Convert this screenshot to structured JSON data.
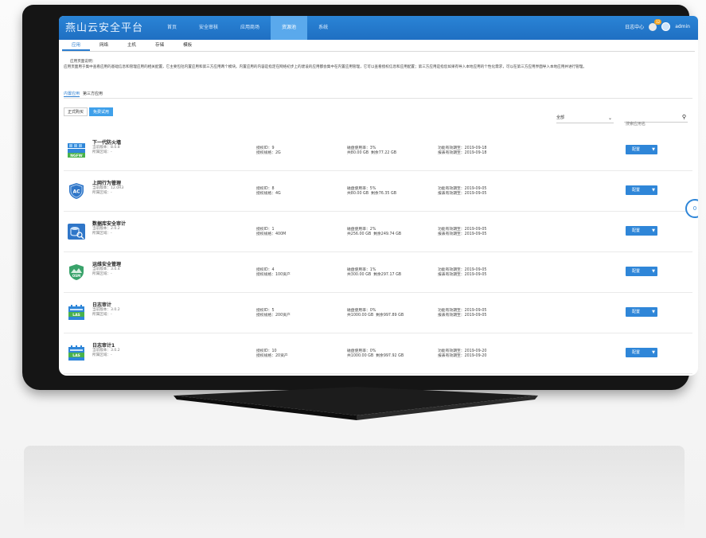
{
  "app": {
    "title": "燕山云安全平台",
    "nav": [
      "首页",
      "安全审核",
      "应用商场",
      "资源池",
      "系统"
    ],
    "nav_active_index": 3,
    "top_right": {
      "link": "日志中心",
      "badge": "12",
      "user": "admin"
    }
  },
  "subtabs": {
    "items": [
      "应用",
      "网络",
      "主机",
      "存储",
      "模板"
    ],
    "active_index": 0
  },
  "description": {
    "title": "应用页面说明：",
    "body": "应用页面用于集中查看应用的基础信息和管理应用的相关配置，它主要包括内置应用和第三方应用两个模块。内置应用的内容是指定在网络初步上的建设的应用都会集中在内置应用管理，它可以查看授权信息和应用配置；第三方应用是指您如果有导入本地应用的个性化需求，可以在第三方应用界面导入本地应用并进行管理。"
  },
  "category_tabs": {
    "items": [
      "内置应用",
      "第三方应用"
    ],
    "active_index": 0
  },
  "filters": {
    "items": [
      "正式购买",
      "免费试用"
    ],
    "active_index": 1
  },
  "select": {
    "value": "全部"
  },
  "search": {
    "placeholder": "搜索应用名"
  },
  "apps": [
    {
      "name": "下一代防火墙",
      "version": "当前版本：8.0.8",
      "zone": "所属区域：-",
      "auth_id": "授权ID：9",
      "auth_spec": "授权规格：2G",
      "disk_usage": "磁盘使用率：3%",
      "disk_total": "共80.00 GB",
      "disk_left": "剩余77.22 GB",
      "func_expire": "功能有效期至：2019-09-18",
      "report_expire": "报表有效期至：2019-09-18",
      "icon": "ngfw-icon",
      "config_label": "配置"
    },
    {
      "name": "上网行为管理",
      "version": "当前版本：12.0R3",
      "zone": "所属区域：-",
      "auth_id": "授权ID：8",
      "auth_spec": "授权规格：4G",
      "disk_usage": "磁盘使用率：5%",
      "disk_total": "共80.00 GB",
      "disk_left": "剩余76.35 GB",
      "func_expire": "功能有效期至：2019-09-05",
      "report_expire": "报表有效期至：2019-09-05",
      "icon": "ac-shield-icon",
      "config_label": "配置"
    },
    {
      "name": "数据库安全审计",
      "version": "当前版本：2.0.2",
      "zone": "所属区域：-",
      "auth_id": "授权ID：1",
      "auth_spec": "授权规格：400M",
      "disk_usage": "磁盘使用率：2%",
      "disk_total": "共256.00 GB",
      "disk_left": "剩余249.74 GB",
      "func_expire": "功能有效期至：2019-09-05",
      "report_expire": "报表有效期至：2019-09-05",
      "icon": "database-audit-icon",
      "config_label": "配置"
    },
    {
      "name": "运维安全管理",
      "version": "当前版本：3.0.4",
      "zone": "所属区域：-",
      "auth_id": "授权ID：4",
      "auth_spec": "授权规格：100资产",
      "disk_usage": "磁盘使用率：1%",
      "disk_total": "共300.00 GB",
      "disk_left": "剩余297.17 GB",
      "func_expire": "功能有效期至：2019-09-05",
      "report_expire": "报表有效期至：2019-09-05",
      "icon": "osm-icon",
      "config_label": "配置"
    },
    {
      "name": "日志审计",
      "version": "当前版本：3.0.2",
      "zone": "所属区域：-",
      "auth_id": "授权ID：5",
      "auth_spec": "授权规格：200资产",
      "disk_usage": "磁盘使用率：0%",
      "disk_total": "共1000.00 GB",
      "disk_left": "剩余997.89 GB",
      "func_expire": "功能有效期至：2019-09-05",
      "report_expire": "报表有效期至：2019-09-05",
      "icon": "las-calendar-icon",
      "config_label": "配置"
    },
    {
      "name": "日志审计1",
      "version": "当前版本：3.0.2",
      "zone": "所属区域：-",
      "auth_id": "授权ID：10",
      "auth_spec": "授权规格：20资产",
      "disk_usage": "磁盘使用率：0%",
      "disk_total": "共1000.00 GB",
      "disk_left": "剩余997.92 GB",
      "func_expire": "功能有效期至：2019-09-20",
      "report_expire": "报表有效期至：2019-09-20",
      "icon": "las-calendar-icon",
      "config_label": "配置"
    }
  ],
  "float_badge": "0",
  "colors": {
    "brand": "#1f6fc2",
    "accent": "#2f86d8",
    "bezel": "#151515",
    "nav_active": "#5aa9ec"
  }
}
